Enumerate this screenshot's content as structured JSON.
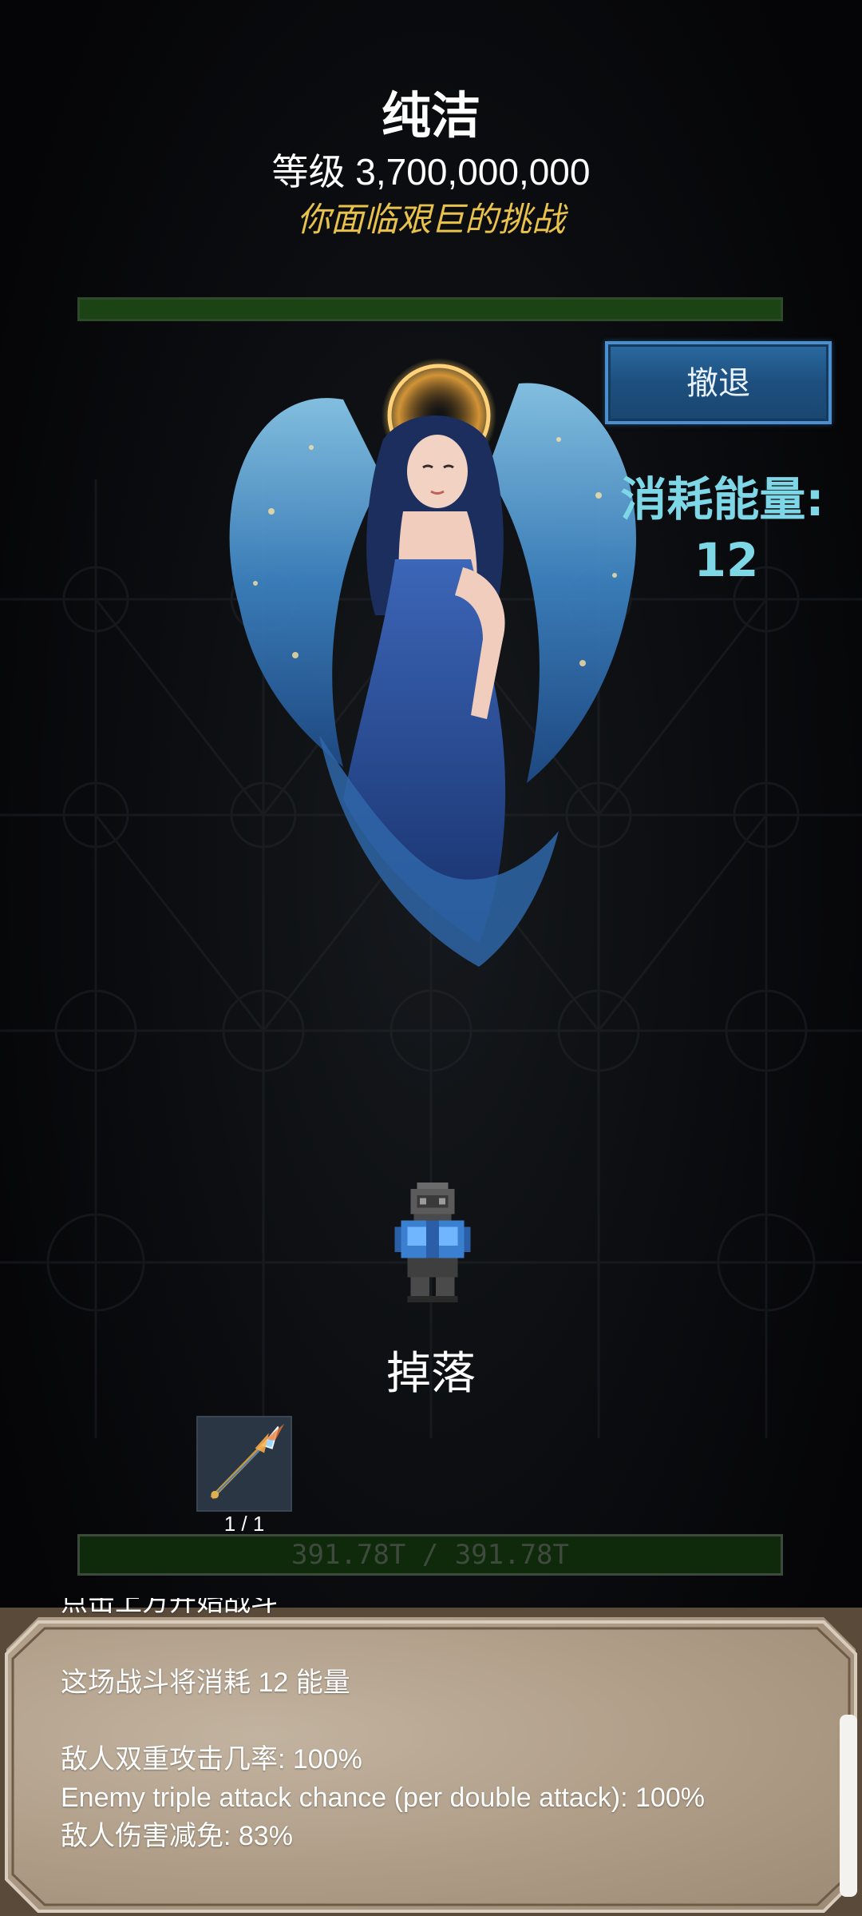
{
  "enemy": {
    "name": "纯洁",
    "level": "等级 3,700,000,000",
    "challenge": "你面临艰巨的挑战"
  },
  "retreat_label": "撤退",
  "energy": {
    "label": "消耗能量:",
    "value": "12"
  },
  "drops": {
    "title": "掉落",
    "items": [
      {
        "icon": "spear-icon",
        "count": "1 / 1"
      }
    ]
  },
  "player_hp": "391.78T / 391.78T",
  "log": {
    "cut_line": "点击上方开始战斗",
    "lines": [
      "这场战斗将消耗 12 能量",
      "",
      "敌人双重攻击几率: 100%",
      "Enemy triple attack chance (per double attack): 100%",
      "敌人伤害减免: 83%"
    ]
  },
  "colors": {
    "background": "#050507",
    "challenge_text": "#e8c24a",
    "energy_text": "#7ed7e6",
    "retreat_button": "#1d4f7e",
    "hp_bar": "#1c4314",
    "log_panel": "#b09e88"
  }
}
